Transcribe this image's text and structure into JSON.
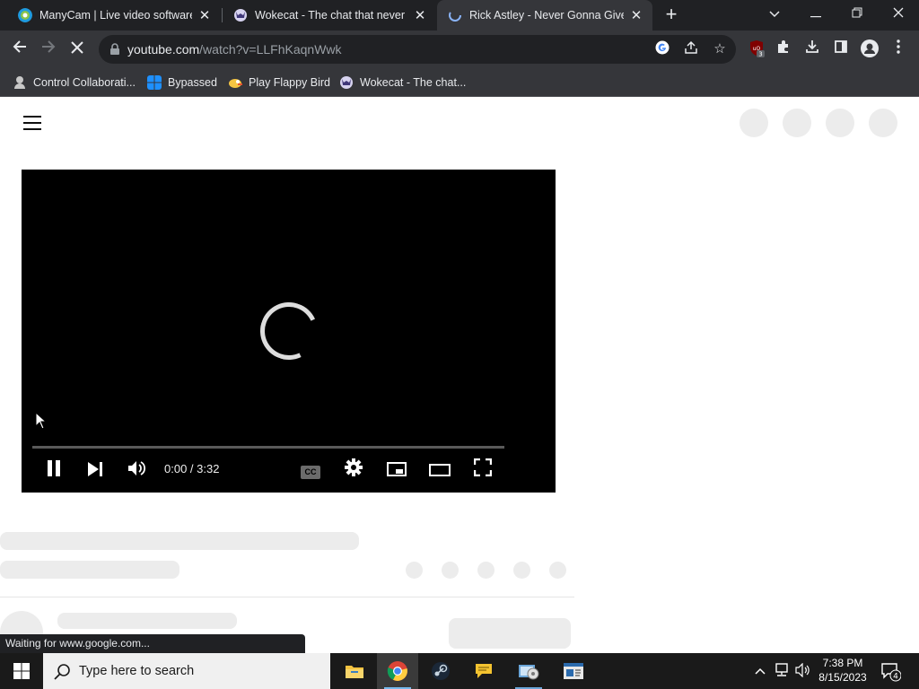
{
  "browser": {
    "tabs": [
      {
        "title": "ManyCam | Live video software &",
        "favicon": "manycam-icon",
        "active": false
      },
      {
        "title": "Wokecat - The chat that never sle",
        "favicon": "wokecat-icon",
        "active": false
      },
      {
        "title": "Rick Astley - Never Gonna Give Y",
        "favicon": "loading-icon",
        "active": true
      }
    ],
    "new_tab_icon": "plus-icon",
    "address": {
      "host": "youtube.com",
      "path": "/watch?v=LLFhKaqnWwk"
    },
    "bookmarks": [
      {
        "label": "Control Collaborati...",
        "icon": "control-icon"
      },
      {
        "label": "Bypassed",
        "icon": "windows-icon"
      },
      {
        "label": "Play Flappy Bird",
        "icon": "flappy-icon"
      },
      {
        "label": "Wokecat - The chat...",
        "icon": "wokecat-icon"
      }
    ],
    "extension_badge": "3",
    "status_text": "Waiting for www.google.com..."
  },
  "player": {
    "time_current": "0:00",
    "time_separator": " / ",
    "time_total": "3:32",
    "cc_label": "CC",
    "progress": 0
  },
  "taskbar": {
    "search_placeholder": "Type here to search",
    "time": "7:38 PM",
    "date": "8/15/2023",
    "notification_count": "4"
  },
  "colors": {
    "chrome_dark": "#202124",
    "chrome_toolbar": "#35363a",
    "player_bg": "#000000",
    "skeleton": "#ececec",
    "taskbar": "#1a1a1a"
  }
}
